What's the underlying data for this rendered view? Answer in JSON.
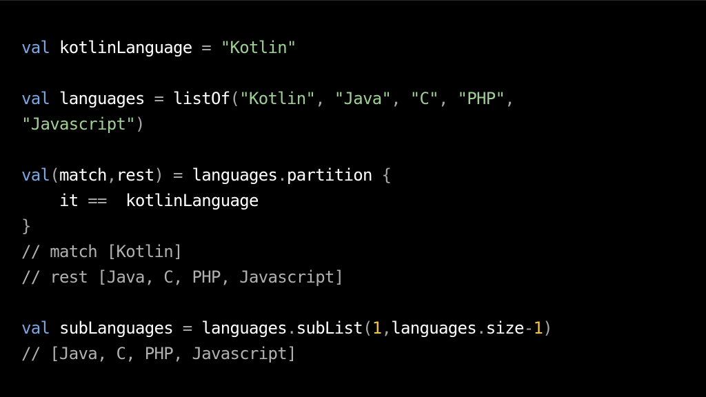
{
  "code_lines": [
    [
      {
        "t": "val",
        "c": "kw"
      },
      {
        "t": " kotlinLanguage ",
        "c": "id"
      },
      {
        "t": "= ",
        "c": "pun"
      },
      {
        "t": "\"Kotlin\"",
        "c": "str"
      }
    ],
    [],
    [
      {
        "t": "val",
        "c": "kw"
      },
      {
        "t": " languages ",
        "c": "id"
      },
      {
        "t": "= ",
        "c": "pun"
      },
      {
        "t": "listOf",
        "c": "id"
      },
      {
        "t": "(",
        "c": "pun"
      },
      {
        "t": "\"Kotlin\"",
        "c": "str"
      },
      {
        "t": ", ",
        "c": "pun"
      },
      {
        "t": "\"Java\"",
        "c": "str"
      },
      {
        "t": ", ",
        "c": "pun"
      },
      {
        "t": "\"C\"",
        "c": "str"
      },
      {
        "t": ", ",
        "c": "pun"
      },
      {
        "t": "\"PHP\"",
        "c": "str"
      },
      {
        "t": ",",
        "c": "pun"
      }
    ],
    [
      {
        "t": "\"Javascript\"",
        "c": "str"
      },
      {
        "t": ")",
        "c": "pun"
      }
    ],
    [],
    [
      {
        "t": "val",
        "c": "kw"
      },
      {
        "t": "(",
        "c": "pun"
      },
      {
        "t": "match",
        "c": "id"
      },
      {
        "t": ",",
        "c": "pun"
      },
      {
        "t": "rest",
        "c": "id"
      },
      {
        "t": ") = ",
        "c": "pun"
      },
      {
        "t": "languages",
        "c": "id"
      },
      {
        "t": ".",
        "c": "pun"
      },
      {
        "t": "partition",
        "c": "id"
      },
      {
        "t": " {",
        "c": "pun"
      }
    ],
    [
      {
        "t": "    it ",
        "c": "id"
      },
      {
        "t": "==  ",
        "c": "pun"
      },
      {
        "t": "kotlinLanguage",
        "c": "id"
      }
    ],
    [
      {
        "t": "}",
        "c": "pun"
      }
    ],
    [
      {
        "t": "// match [Kotlin]",
        "c": "cm"
      }
    ],
    [
      {
        "t": "// rest [Java, C, PHP, Javascript]",
        "c": "cm"
      }
    ],
    [],
    [
      {
        "t": "val",
        "c": "kw"
      },
      {
        "t": " subLanguages ",
        "c": "id"
      },
      {
        "t": "= ",
        "c": "pun"
      },
      {
        "t": "languages",
        "c": "id"
      },
      {
        "t": ".",
        "c": "pun"
      },
      {
        "t": "subList",
        "c": "id"
      },
      {
        "t": "(",
        "c": "pun"
      },
      {
        "t": "1",
        "c": "num"
      },
      {
        "t": ",",
        "c": "pun"
      },
      {
        "t": "languages",
        "c": "id"
      },
      {
        "t": ".",
        "c": "pun"
      },
      {
        "t": "size",
        "c": "id"
      },
      {
        "t": "-",
        "c": "pun"
      },
      {
        "t": "1",
        "c": "num"
      },
      {
        "t": ")",
        "c": "pun"
      }
    ],
    [
      {
        "t": "// [Java, C, PHP, Javascript]",
        "c": "cm"
      }
    ]
  ],
  "colors": {
    "background": "#000000",
    "keyword": "#7ba7e0",
    "string": "#9fce95",
    "number": "#f2c542",
    "punctuation": "#a8a8a8",
    "comment": "#b0b0b0",
    "identifier": "#ffffff"
  }
}
